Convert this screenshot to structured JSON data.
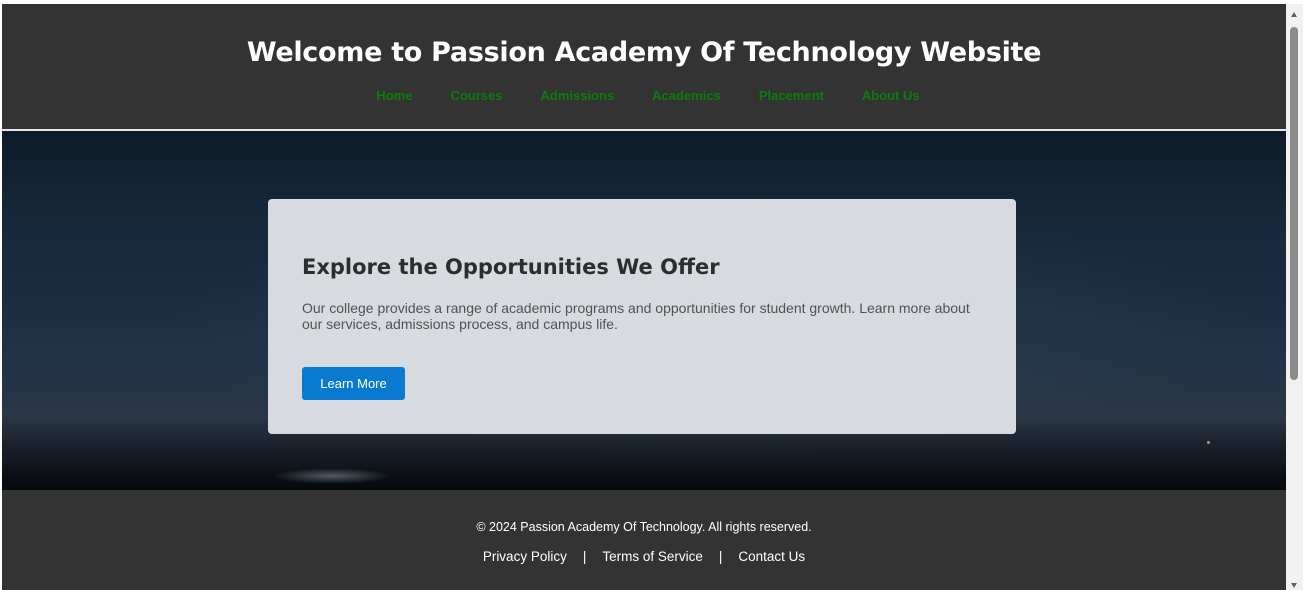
{
  "header": {
    "title": "Welcome to Passion Academy Of Technology Website",
    "nav": [
      {
        "label": "Home"
      },
      {
        "label": "Courses"
      },
      {
        "label": "Admissions"
      },
      {
        "label": "Academics"
      },
      {
        "label": "Placement"
      },
      {
        "label": "About Us"
      }
    ]
  },
  "hero": {
    "heading": "Explore the Opportunities We Offer",
    "description": "Our college provides a range of academic programs and opportunities for student growth. Learn more about our services, admissions process, and campus life.",
    "button_label": "Learn More"
  },
  "footer": {
    "copyright": "© 2024 Passion Academy Of Technology. All rights reserved.",
    "links": [
      {
        "label": "Privacy Policy"
      },
      {
        "label": "Terms of Service"
      },
      {
        "label": "Contact Us"
      }
    ],
    "separator": "|"
  },
  "colors": {
    "header_bg": "#333333",
    "nav_link": "#0a7d0a",
    "card_bg": "#d7dbdf",
    "button_bg": "#0a79d0"
  },
  "scrollbar": {
    "up_icon": "scroll-up-arrow-icon",
    "down_icon": "scroll-down-arrow-icon"
  }
}
